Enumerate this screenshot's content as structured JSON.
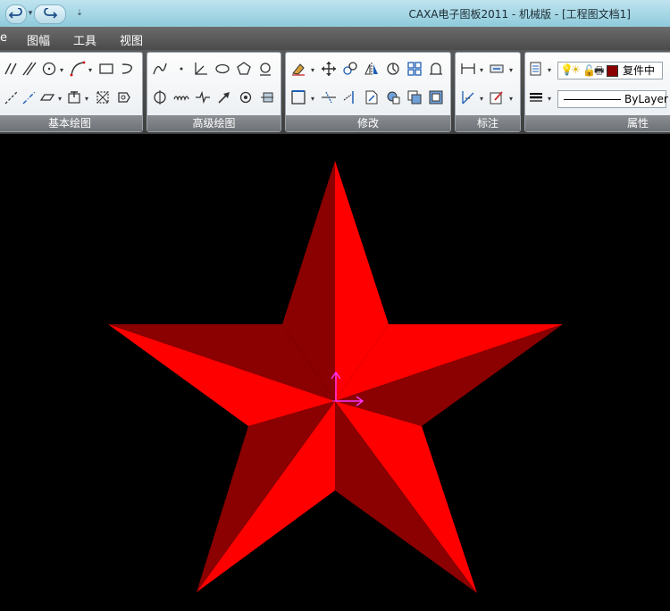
{
  "window": {
    "title": "CAXA电子图板2011 - 机械版 - [工程图文档1]"
  },
  "menubar": {
    "items": [
      "e",
      "图幅",
      "工具",
      "视图"
    ]
  },
  "ribbon": {
    "panels": [
      {
        "label": "基本绘图"
      },
      {
        "label": "高级绘图"
      },
      {
        "label": "修改"
      },
      {
        "label": "标注"
      },
      {
        "label": "属性"
      }
    ],
    "layer_combo": {
      "value": "复件中"
    },
    "linetype_combo": {
      "value": "ByLayer"
    }
  },
  "colors": {
    "star_light": "#ff0000",
    "star_dark": "#8b0000",
    "cursor": "#ff00ff",
    "layer_color": "#8b0000"
  }
}
